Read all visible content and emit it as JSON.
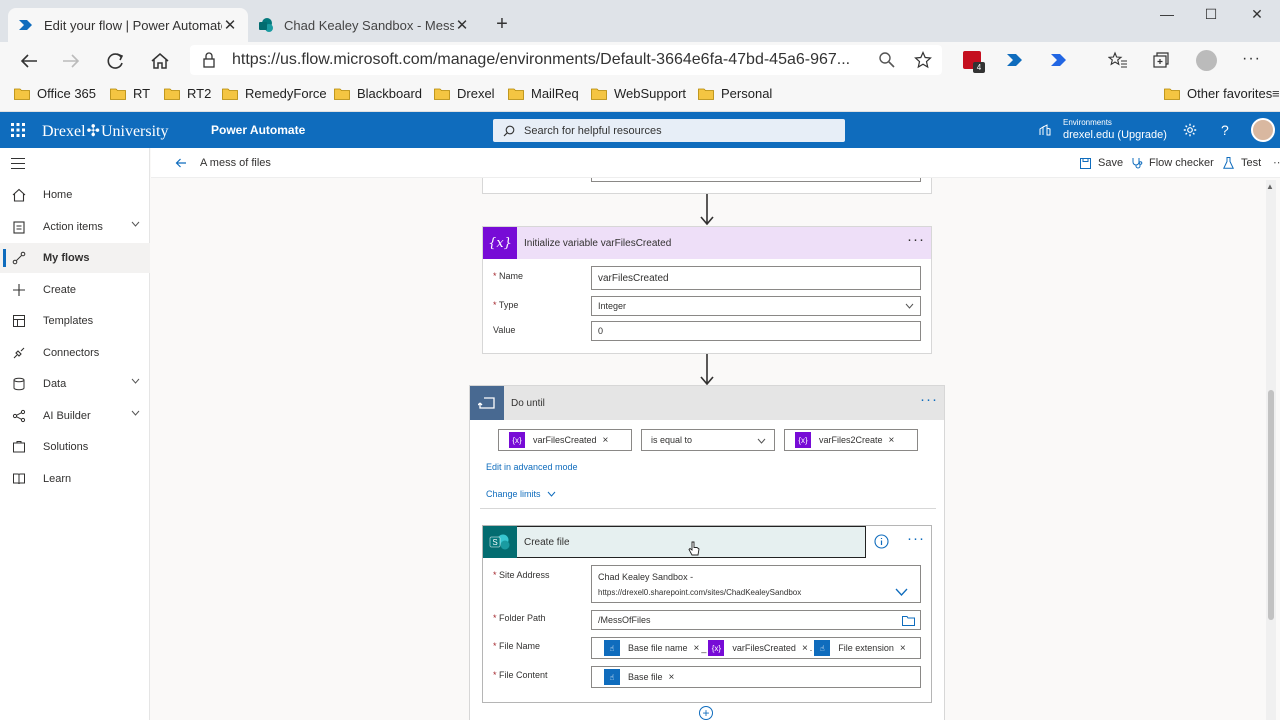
{
  "browser": {
    "tabs": [
      {
        "title": "Edit your flow | Power Automate",
        "icon": "power-automate-icon"
      },
      {
        "title": "Chad Kealey Sandbox - Mess of",
        "icon": "sharepoint-icon"
      }
    ],
    "url": "https://us.flow.microsoft.com/manage/environments/Default-3664e6fa-47bd-45a6-967...",
    "extension_badge": "4",
    "favorites": [
      "Office 365",
      "RT",
      "RT2",
      "RemedyForce",
      "Blackboard",
      "Drexel",
      "MailReq",
      "WebSupport",
      "Personal"
    ],
    "other_favorites": "Other favorites"
  },
  "app": {
    "org": "Drexel",
    "org_suffix": "University",
    "product": "Power Automate",
    "search_placeholder": "Search for helpful resources",
    "env_label": "Environments",
    "env_name": "drexel.edu (Upgrade)"
  },
  "sidebar": {
    "items": [
      {
        "label": "Home",
        "icon": "home-icon"
      },
      {
        "label": "Action items",
        "icon": "clipboard-icon",
        "expand": true
      },
      {
        "label": "My flows",
        "icon": "flow-icon",
        "selected": true
      },
      {
        "label": "Create",
        "icon": "plus-icon"
      },
      {
        "label": "Templates",
        "icon": "templates-icon"
      },
      {
        "label": "Connectors",
        "icon": "connectors-icon"
      },
      {
        "label": "Data",
        "icon": "database-icon",
        "expand": true
      },
      {
        "label": "AI Builder",
        "icon": "ai-builder-icon",
        "expand": true
      },
      {
        "label": "Solutions",
        "icon": "solutions-icon"
      },
      {
        "label": "Learn",
        "icon": "book-icon"
      }
    ]
  },
  "command": {
    "back_title": "A mess of files",
    "save": "Save",
    "checker": "Flow checker",
    "test": "Test"
  },
  "init_var": {
    "title": "Initialize variable varFilesCreated",
    "name_label": "Name",
    "name_value": "varFilesCreated",
    "type_label": "Type",
    "type_value": "Integer",
    "value_label": "Value",
    "value_value": "0",
    "color": "#770bd6"
  },
  "do_until": {
    "title": "Do until",
    "left_token": "varFilesCreated",
    "operator": "is equal to",
    "right_token": "varFiles2Create",
    "advanced_link": "Edit in advanced mode",
    "limits_link": "Change limits"
  },
  "create_file": {
    "title": "Create file",
    "color": "#036c70",
    "site_label": "Site Address",
    "site_line1": "Chad Kealey Sandbox -",
    "site_line2": "https://drexel0.sharepoint.com/sites/ChadKealeySandbox",
    "folder_label": "Folder Path",
    "folder_value": "/MessOfFiles",
    "filename_label": "File Name",
    "filename_tokens": [
      "Base file name",
      "varFilesCreated",
      "File extension"
    ],
    "filename_sep1": "_",
    "filename_sep2": ".",
    "content_label": "File Content",
    "content_token": "Base file"
  }
}
